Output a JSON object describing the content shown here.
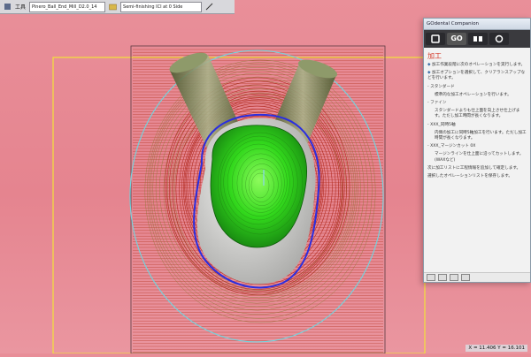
{
  "toolbar": {
    "menu_label": "工具",
    "file_field": "Pinero_Ball_End_Mill_D2.0_14",
    "strategy_field": "Semi-finishing ICI at 0 Side"
  },
  "panel": {
    "title": "GOdental Companion",
    "steps": [
      "",
      "GO",
      "",
      ""
    ],
    "heading": "加工",
    "lines": [
      {
        "text": "加工作業段階に次のオペレーションを実行します。",
        "style": "bullet"
      },
      {
        "text": "加工オプションを選択して、クリアランスアップなどを行います。",
        "style": "bullet"
      },
      {
        "text": "- スタンダード",
        "style": "plain"
      },
      {
        "text": "標準的な加工オペレーションを行います。",
        "style": "indent"
      },
      {
        "text": "- ファイン",
        "style": "plain"
      },
      {
        "text": "スタンダードよりも仕上面を向上させ仕上げます。ただし加工時間が長くなります。",
        "style": "indent"
      },
      {
        "text": "- XXX_同時5軸",
        "style": "plain"
      },
      {
        "text": "内側の加工に同時5軸加工を行います。ただし加工時間が長くなります。",
        "style": "indent"
      },
      {
        "text": "- XXX_マージンカット 0X",
        "style": "plain"
      },
      {
        "text": "マージンラインを仕上面に沿ってカットします。(WAXなど)",
        "style": "indent"
      },
      {
        "text": "次に加工リストに工程情報を追加して確定します。",
        "style": "plain"
      },
      {
        "text": "選択したオペレーションリストを保存します。",
        "style": "plain"
      }
    ]
  },
  "status": {
    "coords": "X = 11.406 Y = 16.101"
  },
  "colors": {
    "background": "#e88e98",
    "mesh_red": "#b0261c",
    "mesh_olive": "#8a7a34",
    "green_surface": "#2fe21a",
    "blue_outline": "#2a2ee0",
    "cyan_circle": "#6fd6e0",
    "yellow_frame": "#f2e23a"
  }
}
